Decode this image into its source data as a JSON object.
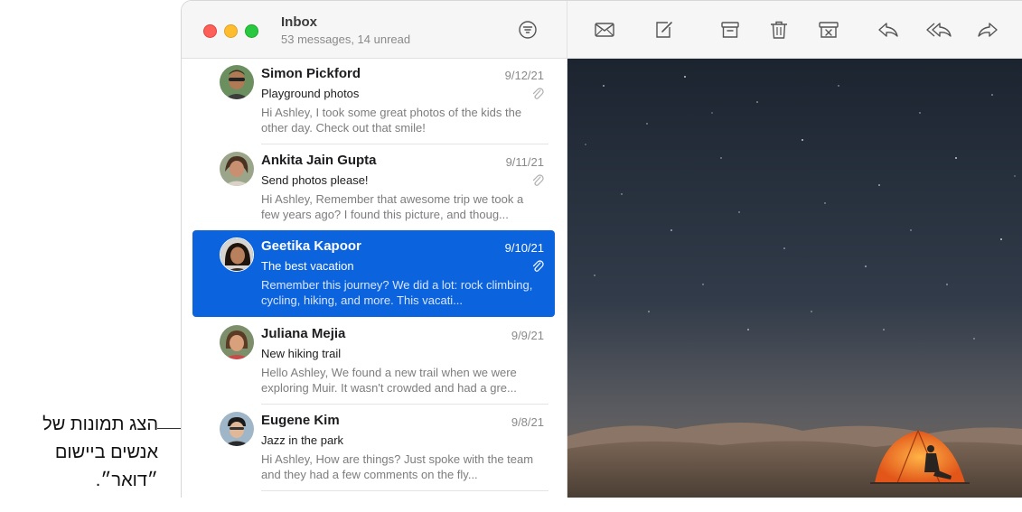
{
  "callout": {
    "lines": [
      "הצג תמונות של",
      "אנשים ביישום",
      "״דואר״."
    ]
  },
  "mailbox": {
    "title": "Inbox",
    "subtitle": "53 messages, 14 unread"
  },
  "toolbar": {
    "icons": [
      "envelope-icon",
      "compose-icon",
      "archive-icon",
      "trash-icon",
      "junk-icon",
      "reply-icon",
      "reply-all-icon",
      "forward-icon"
    ]
  },
  "messages": [
    {
      "sender": "Simon Pickford",
      "date": "9/12/21",
      "subject": "Playground photos",
      "preview": "Hi Ashley, I took some great photos of the kids the other day. Check out that smile!",
      "attachment": true,
      "selected": false
    },
    {
      "sender": "Ankita Jain Gupta",
      "date": "9/11/21",
      "subject": "Send photos please!",
      "preview": "Hi Ashley, Remember that awesome trip we took a few years ago? I found this picture, and thoug...",
      "attachment": true,
      "selected": false
    },
    {
      "sender": "Geetika Kapoor",
      "date": "9/10/21",
      "subject": "The best vacation",
      "preview": "Remember this journey? We did a lot: rock climbing, cycling, hiking, and more. This vacati...",
      "attachment": true,
      "selected": true
    },
    {
      "sender": "Juliana Mejia",
      "date": "9/9/21",
      "subject": "New hiking trail",
      "preview": "Hello Ashley, We found a new trail when we were exploring Muir. It wasn't crowded and had a gre...",
      "attachment": false,
      "selected": false
    },
    {
      "sender": "Eugene Kim",
      "date": "9/8/21",
      "subject": "Jazz in the park",
      "preview": "Hi Ashley, How are things? Just spoke with the team and they had a few comments on the fly...",
      "attachment": false,
      "selected": false
    }
  ],
  "colors": {
    "selection": "#0b63de",
    "traffic_red": "#fe5f57",
    "traffic_yellow": "#febc2e",
    "traffic_green": "#28c840"
  }
}
